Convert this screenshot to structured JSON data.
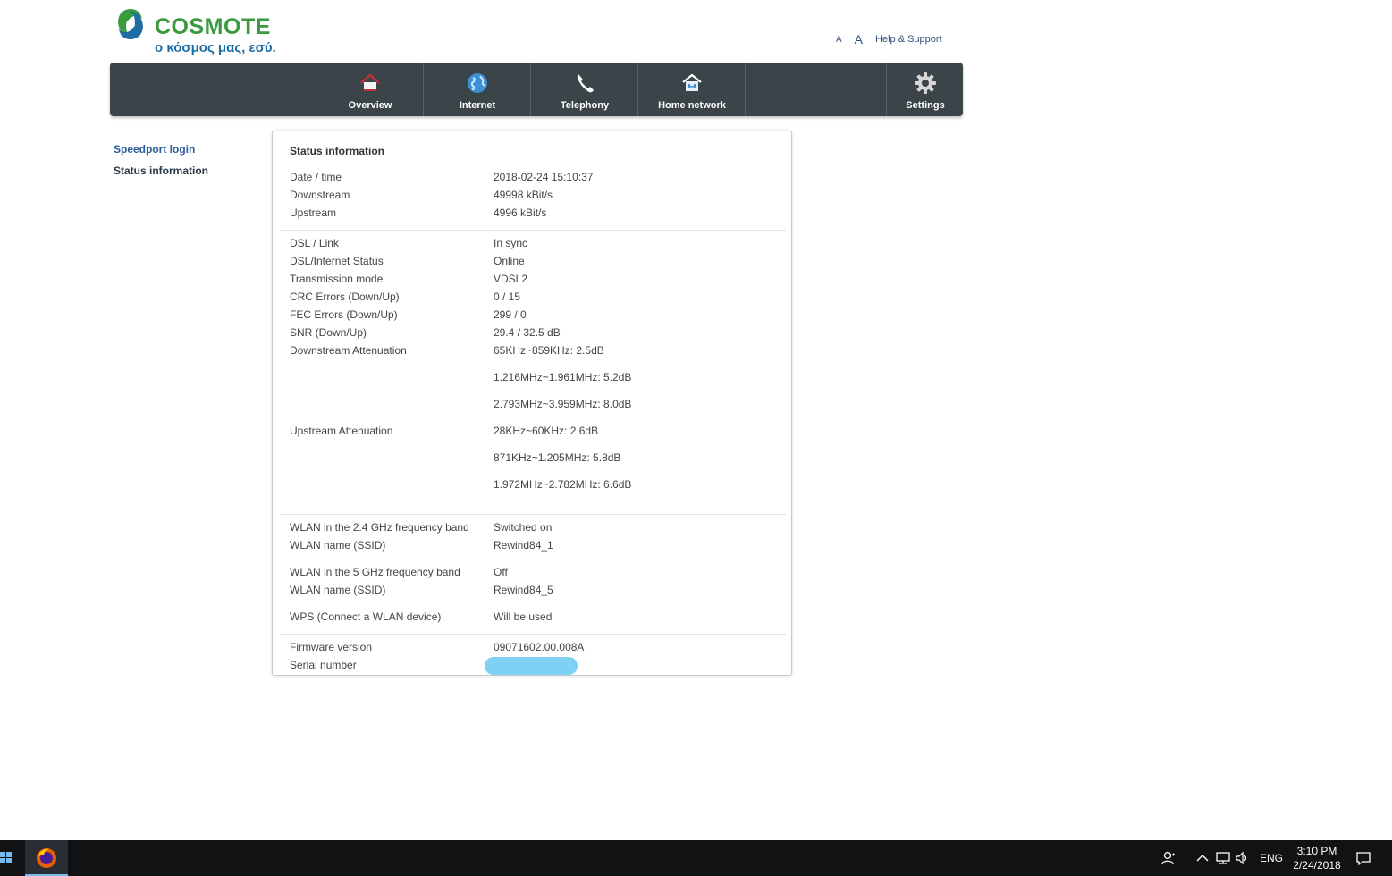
{
  "header": {
    "brand_name": "COSMOTE",
    "slogan": "ο κόσμος μας, εσύ.",
    "font_small_label": "A",
    "font_large_label": "A",
    "help_label": "Help & Support"
  },
  "nav": {
    "items": [
      {
        "label": "Overview",
        "icon": "house-icon"
      },
      {
        "label": "Internet",
        "icon": "globe-icon"
      },
      {
        "label": "Telephony",
        "icon": "phone-handset-icon"
      },
      {
        "label": "Home network",
        "icon": "home-network-icon"
      },
      {
        "label": "Settings",
        "icon": "gear-icon"
      }
    ]
  },
  "sidebar": {
    "items": [
      {
        "label": "Speedport login"
      },
      {
        "label": "Status information"
      }
    ]
  },
  "panel": {
    "title": "Status information",
    "rows": [
      {
        "label": "Date / time",
        "value": "2018-02-24 15:10:37"
      },
      {
        "label": "Downstream",
        "value": "49998 kBit/s"
      },
      {
        "label": "Upstream",
        "value": "4996 kBit/s"
      },
      {
        "label": "DSL / Link",
        "value": "In sync"
      },
      {
        "label": "DSL/Internet Status",
        "value": "Online"
      },
      {
        "label": "Transmission mode",
        "value": "VDSL2"
      },
      {
        "label": "CRC Errors (Down/Up)",
        "value": "0 / 15"
      },
      {
        "label": "FEC Errors (Down/Up)",
        "value": "299 / 0"
      },
      {
        "label": "SNR (Down/Up)",
        "value": "29.4 / 32.5 dB"
      },
      {
        "label": "Downstream Attenuation",
        "value": "65KHz~859KHz: 2.5dB"
      },
      {
        "label": "",
        "value": "1.216MHz~1.961MHz: 5.2dB"
      },
      {
        "label": "",
        "value": "2.793MHz~3.959MHz: 8.0dB"
      },
      {
        "label": "Upstream Attenuation",
        "value": "28KHz~60KHz: 2.6dB"
      },
      {
        "label": "",
        "value": "871KHz~1.205MHz: 5.8dB"
      },
      {
        "label": "",
        "value": "1.972MHz~2.782MHz: 6.6dB"
      },
      {
        "label": "WLAN in the 2.4 GHz frequency band",
        "value": "Switched on"
      },
      {
        "label": "WLAN name (SSID)",
        "value": "Rewind84_1"
      },
      {
        "label": "WLAN in the 5 GHz frequency band",
        "value": "Off"
      },
      {
        "label": "WLAN name (SSID)",
        "value": "Rewind84_5"
      },
      {
        "label": "WPS (Connect a WLAN device)",
        "value": "Will be used"
      },
      {
        "label": "Firmware version",
        "value": "09071602.00.008A"
      },
      {
        "label": "Serial number",
        "value": ""
      }
    ]
  },
  "taskbar": {
    "language": "ENG",
    "time": "3:10 PM",
    "date": "2/24/2018"
  },
  "colors": {
    "brand_green": "#3a9a3e",
    "brand_blue": "#1c6ea4",
    "navbar_bg": "#3b4448",
    "link_blue": "#2d5d9a"
  }
}
